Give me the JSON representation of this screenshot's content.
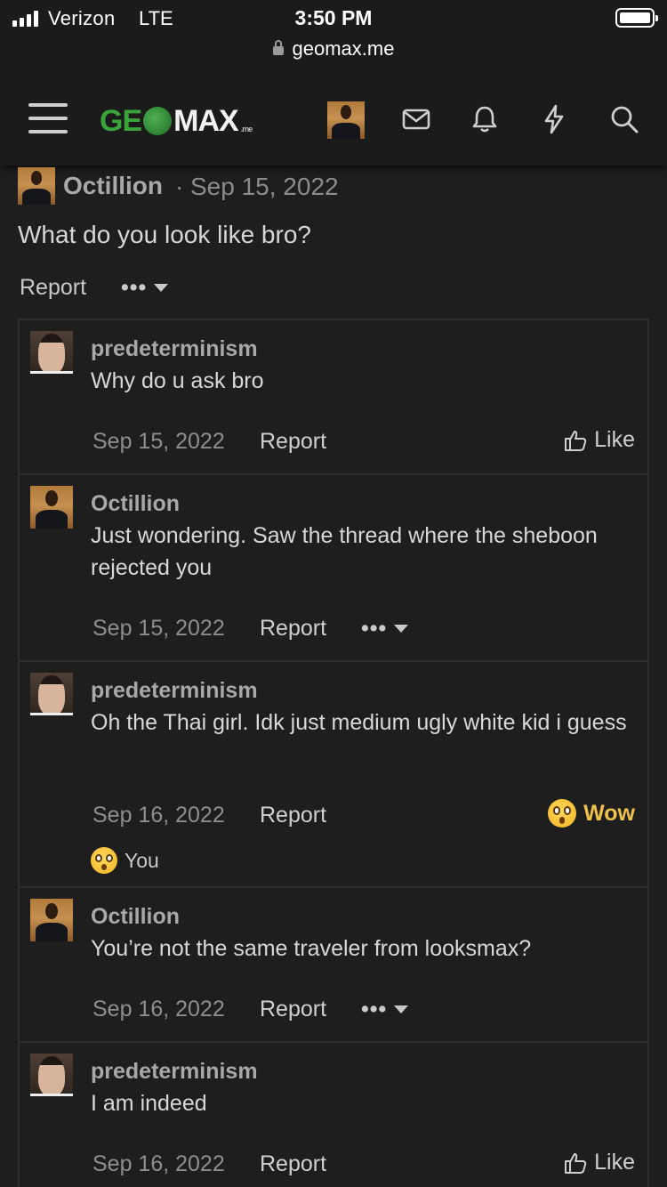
{
  "status_bar": {
    "carrier": "Verizon",
    "network": "LTE",
    "time": "3:50 PM",
    "url": "geomax.me"
  },
  "header": {
    "logo_left": "GE",
    "logo_right": "MAX",
    "logo_suffix": ".me",
    "icons": [
      "menu-icon",
      "user-avatar",
      "mail-icon",
      "bell-icon",
      "bolt-icon",
      "search-icon"
    ]
  },
  "op_post": {
    "author": "Octillion",
    "separator": "·",
    "date": "Sep 15, 2022",
    "text": "What do you look like bro?",
    "report_label": "Report",
    "more_label": "•••"
  },
  "comments": [
    {
      "author": "predeterminism",
      "text": "Why do u ask bro",
      "date": "Sep 15, 2022",
      "report_label": "Report",
      "action": "Like"
    },
    {
      "author": "Octillion",
      "text": "Just wondering. Saw the thread where the sheboon rejected you",
      "date": "Sep 15, 2022",
      "report_label": "Report",
      "action": "•••"
    },
    {
      "author": "predeterminism",
      "text": "Oh the Thai girl. Idk just medium ugly white kid i guess",
      "date": "Sep 16, 2022",
      "report_label": "Report",
      "action": "Wow",
      "reaction_by": "You"
    },
    {
      "author": "Octillion",
      "text": "You’re not the same traveler from looksmax?",
      "date": "Sep 16, 2022",
      "report_label": "Report",
      "action": "•••"
    },
    {
      "author": "predeterminism",
      "text": "I am indeed",
      "date": "Sep 16, 2022",
      "report_label": "Report",
      "action": "Like"
    }
  ],
  "colors": {
    "background": "#1e1e1e",
    "logo_green": "#3aa43a",
    "wow_yellow": "#f0c14a",
    "muted_text": "#8e8e8e"
  }
}
